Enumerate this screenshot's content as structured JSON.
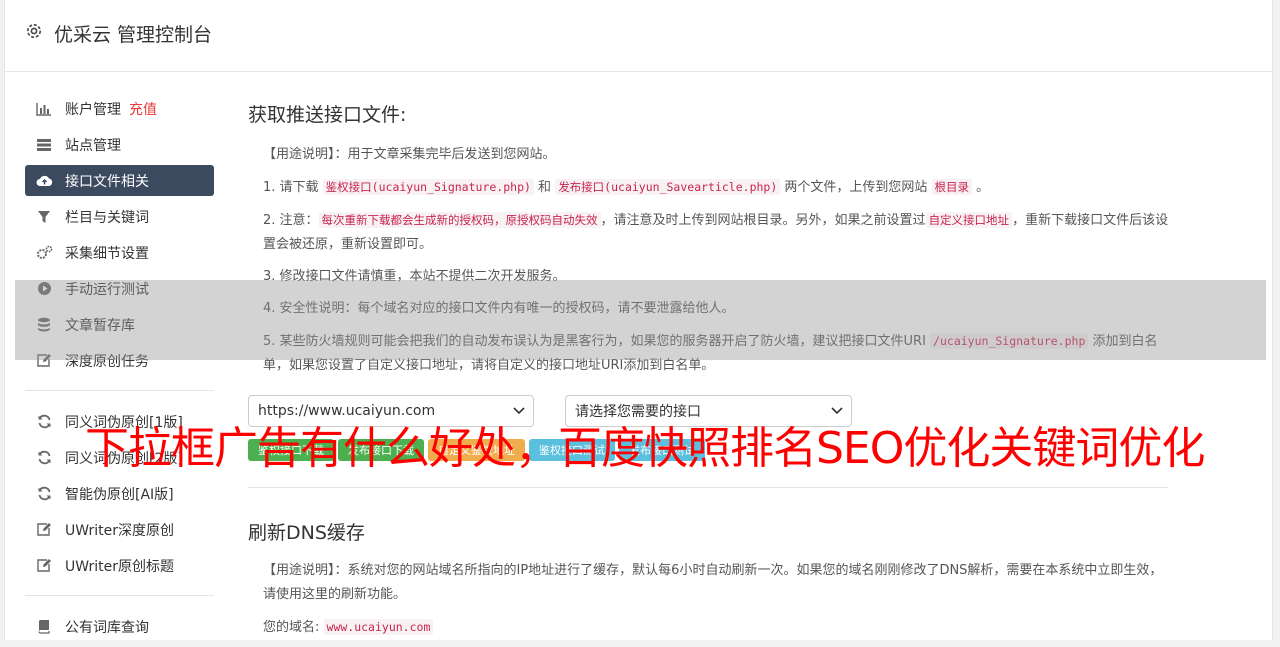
{
  "header": {
    "title": "优采云 管理控制台"
  },
  "sidebar": {
    "group1": [
      {
        "label": "账户管理",
        "icon": "bar-chart-icon",
        "extra": "充值"
      },
      {
        "label": "站点管理",
        "icon": "server-icon"
      },
      {
        "label": "接口文件相关",
        "icon": "cloud-upload-icon",
        "active": true
      },
      {
        "label": "栏目与关键词",
        "icon": "filter-icon"
      },
      {
        "label": "采集细节设置",
        "icon": "cogs-icon"
      },
      {
        "label": "手动运行测试",
        "icon": "play-circle-icon"
      },
      {
        "label": "文章暂存库",
        "icon": "database-icon"
      },
      {
        "label": "深度原创任务",
        "icon": "edit-icon"
      }
    ],
    "group2": [
      {
        "label": "同义词伪原创[1版]",
        "icon": "refresh-icon"
      },
      {
        "label": "同义词伪原创[2版]",
        "icon": "refresh-icon"
      },
      {
        "label": "智能伪原创[AI版]",
        "icon": "refresh-icon"
      },
      {
        "label": "UWriter深度原创",
        "icon": "edit-icon"
      },
      {
        "label": "UWriter原创标题",
        "icon": "edit-icon"
      }
    ],
    "group3": [
      {
        "label": "公有词库查询",
        "icon": "book-icon"
      }
    ]
  },
  "main": {
    "section1": {
      "title": "获取推送接口文件:",
      "usage": "【用途说明】：用于文章采集完毕后发送到您网站。",
      "item1_pre": "1. 请下载 ",
      "item1_code1": "鉴权接口(ucaiyun_Signature.php)",
      "item1_mid": " 和 ",
      "item1_code2": "发布接口(ucaiyun_Savearticle.php)",
      "item1_post": " 两个文件，上传到您网站 ",
      "item1_code3": "根目录",
      "item1_end": " 。",
      "item2_pre": "2. 注意：",
      "item2_code1": "每次重新下载都会生成新的授权码，原授权码自动失效",
      "item2_mid": "，请注意及时上传到网站根目录。另外，如果之前设置过",
      "item2_code2": "自定义接口地址",
      "item2_post": "，重新下载接口文件后该设置会被还原，重新设置即可。",
      "item3": "3. 修改接口文件请慎重，本站不提供二次开发服务。",
      "item4": "4. 安全性说明：每个域名对应的接口文件内有唯一的授权码，请不要泄露给他人。",
      "item5_pre": "5. 某些防火墙规则可能会把我们的自动发布误认为是黑客行为，如果您的服务器开启了防火墙，建议把接口文件URI ",
      "item5_code": "/ucaiyun_Signature.php",
      "item5_post": " 添加到白名单，如果您设置了自定义接口地址，请将自定义的接口地址URI添加到白名单。",
      "select_site": "https://www.ucaiyun.com",
      "select_api": "请选择您需要的接口",
      "buttons": [
        {
          "label": "鉴权接口下载",
          "color": "#4caf50"
        },
        {
          "label": "发布接口下载",
          "color": "#4caf50"
        },
        {
          "label": "自定义鉴权地址",
          "color": "#f0ad4e"
        },
        {
          "label": "鉴权接口测试",
          "color": "#5bc0de"
        },
        {
          "label": "发布接口测试",
          "color": "#5bc0de"
        }
      ]
    },
    "section2": {
      "title": "刷新DNS缓存",
      "usage": "【用途说明】：系统对您的网站域名所指向的IP地址进行了缓存，默认每6小时自动刷新一次。如果您的域名刚刚修改了DNS解析，需要在本系统中立即生效，请使用这里的刷新功能。",
      "domain_label": "您的域名: ",
      "domain_value": "www.ucaiyun.com"
    }
  },
  "ad_banner": "下拉框广告有什么好处，百度快照排名SEO优化关键词优化"
}
